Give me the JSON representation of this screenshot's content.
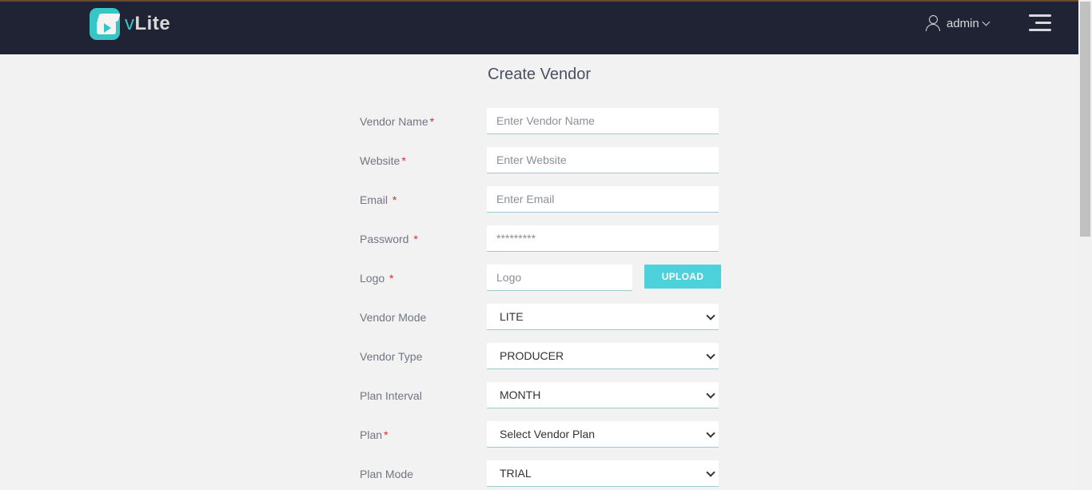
{
  "header": {
    "brand_prefix": "v",
    "brand_name": "Lite",
    "user_name": "admin"
  },
  "page": {
    "title": "Create Vendor"
  },
  "form": {
    "vendor_name": {
      "label": "Vendor Name",
      "required": "*",
      "placeholder": "Enter Vendor Name"
    },
    "website": {
      "label": "Website",
      "required": "*",
      "placeholder": "Enter Website"
    },
    "email": {
      "label": "Email ",
      "required": "*",
      "placeholder": "Enter Email"
    },
    "password": {
      "label": "Password ",
      "required": "*",
      "placeholder": "*********"
    },
    "logo": {
      "label": "Logo ",
      "required": "*",
      "placeholder": "Logo",
      "upload_label": "UPLOAD"
    },
    "vendor_mode": {
      "label": "Vendor Mode",
      "value": "LITE"
    },
    "vendor_type": {
      "label": "Vendor Type",
      "value": "PRODUCER"
    },
    "plan_interval": {
      "label": "Plan Interval",
      "value": "MONTH"
    },
    "plan": {
      "label": "Plan",
      "required": "*",
      "value": "Select Vendor Plan"
    },
    "plan_mode": {
      "label": "Plan Mode",
      "value": "TRIAL"
    }
  },
  "colors": {
    "navbar": "#1f2333",
    "accent": "#37c6c6",
    "upload_button": "#4dd2dc",
    "required": "#e0282f"
  }
}
